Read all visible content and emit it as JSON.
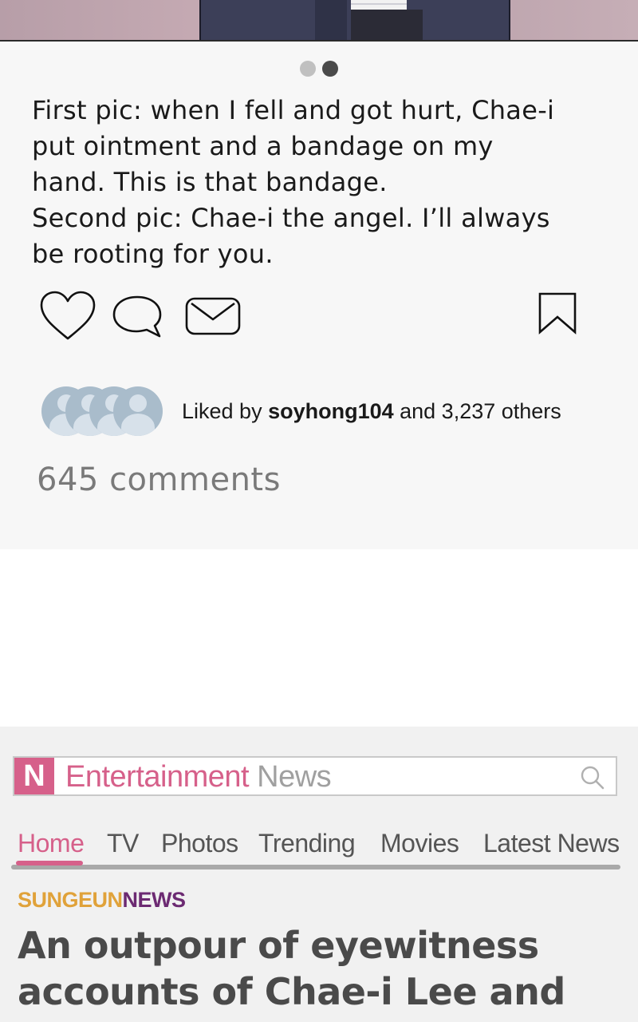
{
  "post": {
    "carousel": {
      "count": 2,
      "active_index": 1
    },
    "caption_lines": [
      "First pic: when I fell and got hurt, Chae-i",
      "put ointment and a bandage on my",
      "hand. This is that bandage.",
      "Second pic: Chae-i the angel. I’ll always",
      "be rooting for you."
    ],
    "actions": {
      "like_icon": "heart-outline-icon",
      "comment_icon": "speech-bubble-icon",
      "share_icon": "envelope-icon",
      "save_icon": "bookmark-icon"
    },
    "likes": {
      "prefix": "Liked by ",
      "user": "soyhong104",
      "suffix": " and 3,237 others"
    },
    "comments_label": "645 comments"
  },
  "news": {
    "logo_letter": "N",
    "brand_primary": "Entertainment",
    "brand_secondary": " News",
    "tabs": [
      "Home",
      "TV",
      "Photos",
      "Trending",
      "Movies",
      "Latest News"
    ],
    "active_tab": "Home",
    "source_part1": "SUNGEUN",
    "source_part2": "NEWS",
    "headline_lines": [
      "An outpour of eyewitness",
      "accounts of Chae-i Lee and"
    ],
    "colors": {
      "accent_pink": "#d6608a",
      "source_orange": "#e0a23a",
      "source_purple": "#6c2a72"
    }
  }
}
